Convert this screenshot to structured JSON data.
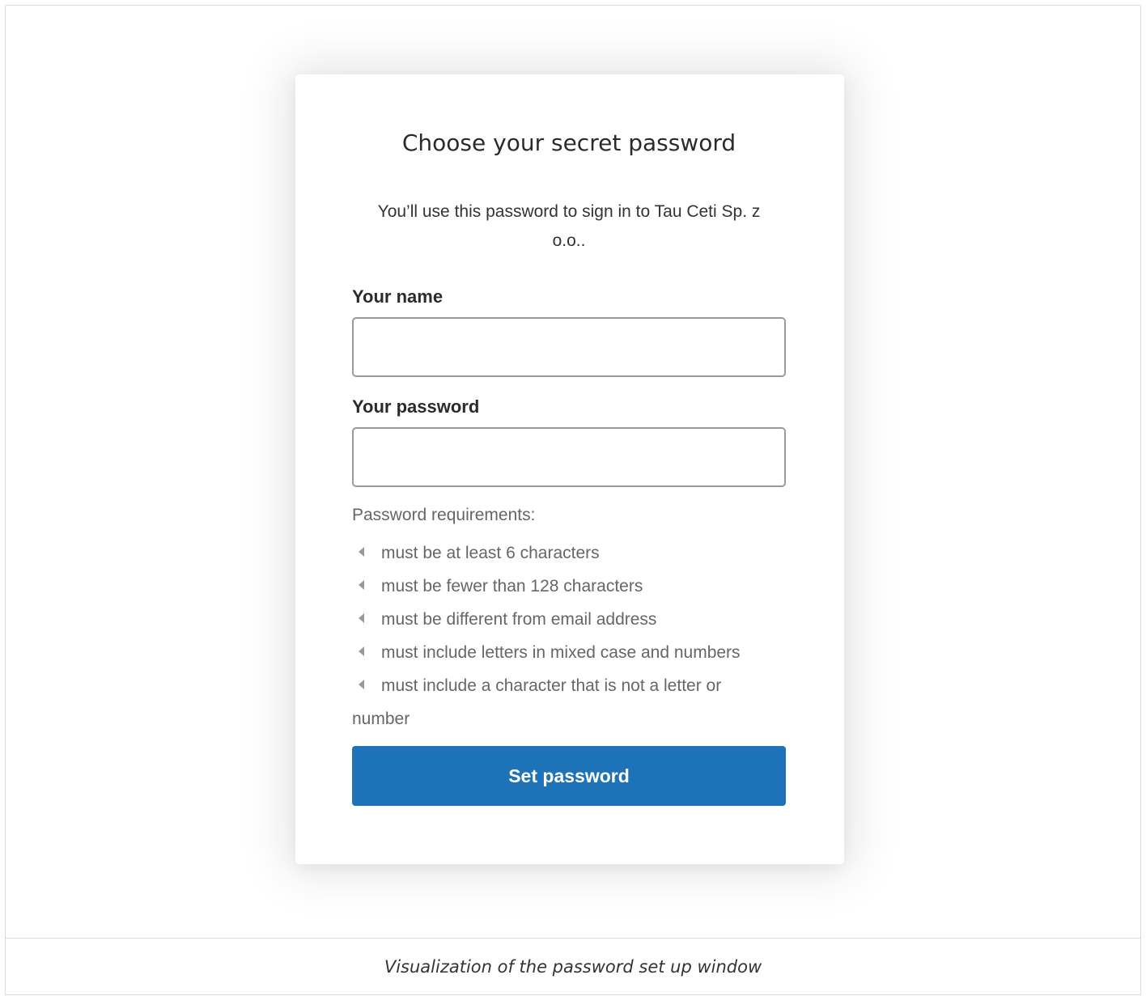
{
  "form": {
    "title": "Choose your secret password",
    "subtitle_line1": "You’ll use this password to sign in to Tau Ceti Sp. z",
    "subtitle_line2": "o.o..",
    "name_label": "Your name",
    "name_value": "",
    "password_label": "Your password",
    "password_value": "",
    "requirements_heading": "Password requirements:",
    "requirements": [
      "must be at least 6 characters",
      "must be fewer than 128 characters",
      "must be different from email address",
      "must include letters in mixed case and numbers",
      "must include a character that is not a letter or"
    ],
    "requirements_wrap": "number",
    "submit_label": "Set password"
  },
  "caption": "Visualization of the password set up window",
  "colors": {
    "button": "#1e72b8",
    "requirement_text": "#666666",
    "bullet": "#999999"
  },
  "icons": {
    "requirement_bullet": "caret-left-icon"
  }
}
